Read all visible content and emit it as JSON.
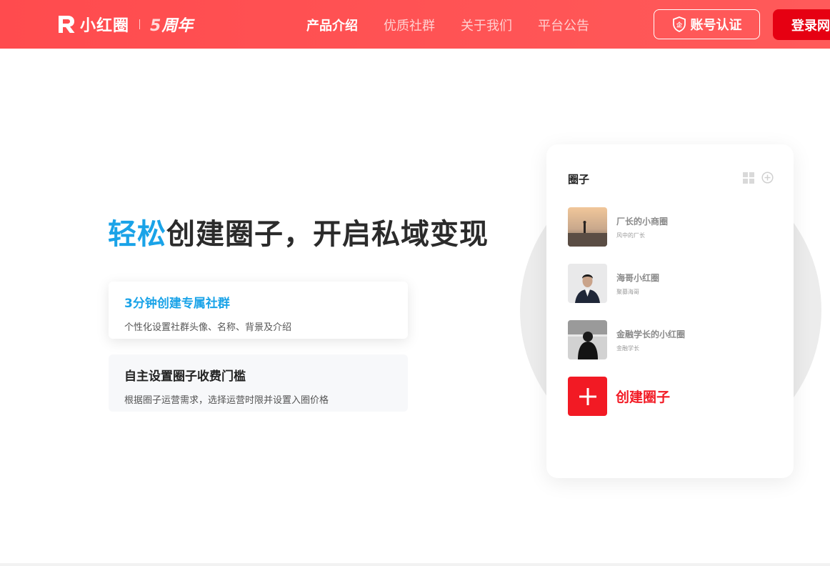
{
  "header": {
    "logo_text": "小红圈",
    "anniversary_num": "5",
    "anniversary_text": "周年",
    "nav": [
      {
        "label": "产品介绍",
        "active": true
      },
      {
        "label": "优质社群",
        "active": false
      },
      {
        "label": "关于我们",
        "active": false
      },
      {
        "label": "平台公告",
        "active": false
      }
    ],
    "verify_label": "账号认证",
    "login_label": "登录网"
  },
  "hero": {
    "headline_accent": "轻松",
    "headline_rest": "创建圈子，开启私域变现",
    "features": [
      {
        "title": "3分钟创建专属社群",
        "desc": "个性化设置社群头像、名称、背景及介绍"
      },
      {
        "title": "自主设置圈子收费门槛",
        "desc": "根据圈子运营需求，选择运营时限并设置入圈价格"
      }
    ]
  },
  "card": {
    "title": "圈子",
    "items": [
      {
        "name": "厂长的小商圈",
        "owner": "风中的厂长"
      },
      {
        "name": "海哥小红圈",
        "owner": "聚募海哥"
      },
      {
        "name": "金融学长的小红圈",
        "owner": "金融学长"
      }
    ],
    "create_label": "创建圈子"
  },
  "colors": {
    "brand_red": "#ff4d4f",
    "accent_blue": "#1aa3e8",
    "create_red": "#f21a24"
  },
  "icons": [
    "logo-r-icon",
    "shield-icon",
    "grid-icon",
    "plus-circle-icon",
    "plus-icon"
  ]
}
